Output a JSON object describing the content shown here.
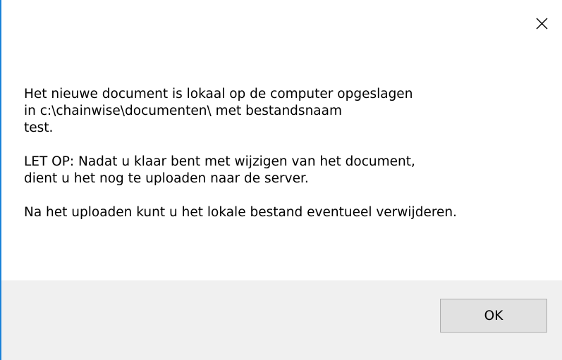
{
  "dialog": {
    "close_icon": "close-icon",
    "accent_color": "#1a82d8",
    "message": {
      "paragraph1": {
        "line1": "Het nieuwe document is lokaal op de computer opgeslagen",
        "line2": "in c:\\chainwise\\documenten\\ met bestandsnaam",
        "line3": "test."
      },
      "paragraph2": {
        "line1": "LET OP: Nadat u klaar bent met wijzigen van het document,",
        "line2": "dient u het nog te uploaden naar de server."
      },
      "paragraph3": {
        "line1": "Na het uploaden kunt u het lokale bestand eventueel verwijderen."
      }
    },
    "ok_label": "OK"
  }
}
